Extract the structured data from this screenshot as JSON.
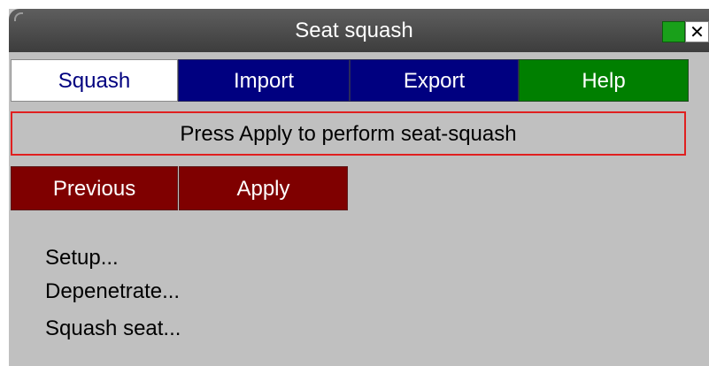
{
  "window": {
    "title": "Seat squash",
    "close_glyph": "✕"
  },
  "tabs": [
    {
      "label": "Squash",
      "active": true
    },
    {
      "label": "Import",
      "active": false
    },
    {
      "label": "Export",
      "active": false
    },
    {
      "label": "Help",
      "active": false
    }
  ],
  "status": {
    "message": "Press Apply to perform seat-squash"
  },
  "actions": {
    "previous_label": "Previous",
    "apply_label": "Apply"
  },
  "menu": {
    "items": [
      {
        "label": "Setup..."
      },
      {
        "label": "Depenetrate..."
      },
      {
        "label": "Squash seat..."
      }
    ]
  },
  "colors": {
    "tab_active_bg": "#ffffff",
    "tab_active_text": "#00007f",
    "tab_blue": "#000080",
    "tab_help_green": "#007f00",
    "button_red": "#7f0000",
    "message_border": "#e02020",
    "window_bg": "#c0c0c0",
    "titlebar": "#4a4a4a"
  },
  "icons": {
    "green_indicator": "green-square-icon",
    "close": "close-icon"
  }
}
